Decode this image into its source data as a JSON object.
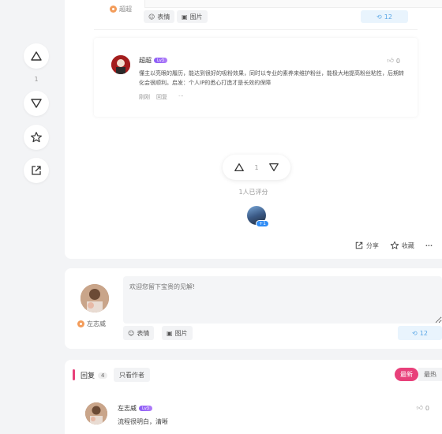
{
  "rail": {
    "vote_count": "1"
  },
  "prev_comment": {
    "author": "超超",
    "emoji_label": "表情",
    "image_label": "图片",
    "send_count": "12"
  },
  "reply": {
    "author": "超超",
    "level": "Lv3",
    "text": "懂主以亮眼的履历，能达到很好的吸粉效果，同时以专业的素养来维护粉丝，能极大地提高粉丝粘性，后期转化会很顺利。启发：个人IP的悉心打造才是长效的保障",
    "time": "刚刚",
    "reply_label": "回复",
    "more": "···",
    "likes": "0"
  },
  "vote": {
    "count": "1",
    "rated_text": "1人已评分",
    "rater_plus": "+1"
  },
  "actions": {
    "share": "分享",
    "favorite": "收藏",
    "more": "···"
  },
  "composer": {
    "placeholder": "欢迎您留下宝贵的见解!",
    "username": "左志威",
    "emoji_label": "表情",
    "image_label": "图片",
    "send_count": "12"
  },
  "replies": {
    "title": "回复",
    "count": "4",
    "only_author": "只看作者",
    "sort_new": "最新",
    "sort_hot": "最热",
    "items": [
      {
        "author": "左志威",
        "level": "Lv3",
        "text": "流程很明白，清晰",
        "likes": "0"
      }
    ]
  },
  "colors": {
    "accent": "#e8407a",
    "send_blue": "#5aa7e6",
    "level_purple": "#8a5cf6"
  }
}
